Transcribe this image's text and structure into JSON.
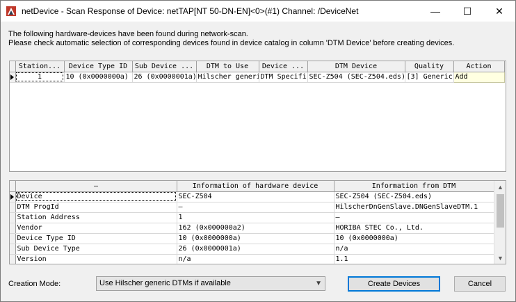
{
  "window": {
    "title": "netDevice - Scan Response of Device: netTAP[NT 50-DN-EN]<0>(#1) Channel: /DeviceNet",
    "minimize_glyph": "—",
    "maximize_glyph": "☐",
    "close_glyph": "✕"
  },
  "info": {
    "line1": "The following hardware-devices have been found during network-scan.",
    "line2": "Please check automatic selection of corresponding devices found  in device catalog in column 'DTM Device' before creating devices."
  },
  "scan_grid": {
    "columns": [
      "Station...",
      "Device Type ID",
      "Sub Device ...",
      "DTM to Use",
      "Device ...",
      "DTM Device",
      "Quality",
      "Action"
    ],
    "rows": [
      {
        "station": "1",
        "device_type_id": "10 (0x0000000a)",
        "sub_device": "26 (0x0000001a)",
        "dtm_to_use": "Hilscher generi",
        "device_class": "DTM Specifi",
        "dtm_device": "SEC-Z504 (SEC-Z504.eds)",
        "quality": "[3] Generic",
        "action": "Add"
      }
    ]
  },
  "info_grid": {
    "columns": [
      "—",
      "Information of hardware device",
      "Information from DTM"
    ],
    "rows": [
      {
        "name": "Device",
        "hw": "SEC-Z504",
        "dtm": "SEC-Z504 (SEC-Z504.eds)"
      },
      {
        "name": "DTM ProgId",
        "hw": "—",
        "dtm": "HilscherDnGenSlave.DNGenSlaveDTM.1"
      },
      {
        "name": "Station Address",
        "hw": "1",
        "dtm": "—"
      },
      {
        "name": "Vendor",
        "hw": "162 (0x000000a2)",
        "dtm": "HORIBA STEC Co., Ltd."
      },
      {
        "name": "Device Type ID",
        "hw": "10 (0x0000000a)",
        "dtm": "10 (0x0000000a)"
      },
      {
        "name": "Sub Device Type",
        "hw": "26 (0x0000001a)",
        "dtm": "n/a"
      },
      {
        "name": "Version",
        "hw": "n/a",
        "dtm": "1.1"
      }
    ]
  },
  "footer": {
    "creation_mode_label": "Creation Mode:",
    "creation_mode_value": "Use Hilscher generic DTMs if available",
    "create_button": "Create Devices",
    "cancel_button": "Cancel"
  },
  "colors": {
    "accent": "#0078d7",
    "action_cell": "#ffffe1"
  }
}
